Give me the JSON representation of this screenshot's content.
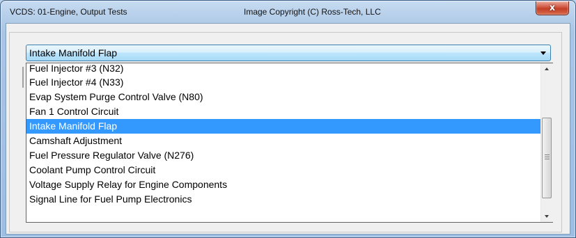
{
  "window": {
    "title": "VCDS: 01-Engine,  Output Tests",
    "copyright": "Image Copyright (C) Ross-Tech, LLC",
    "close_label": "x"
  },
  "combo": {
    "selected": "Intake Manifold Flap"
  },
  "list": {
    "items": [
      "Fuel Injector #3 (N32)",
      "Fuel Injector #4 (N33)",
      "Evap System Purge Control Valve (N80)",
      "Fan 1 Control Circuit",
      "Intake Manifold Flap",
      "Camshaft Adjustment",
      "Fuel Pressure Regulator Valve (N276)",
      "Coolant Pump Control Circuit",
      "Voltage Supply Relay for Engine Components",
      "Signal Line for Fuel Pump Electronics"
    ],
    "selected_index": 4
  },
  "colors": {
    "selection": "#3399ff",
    "close_button": "#c23f26"
  }
}
